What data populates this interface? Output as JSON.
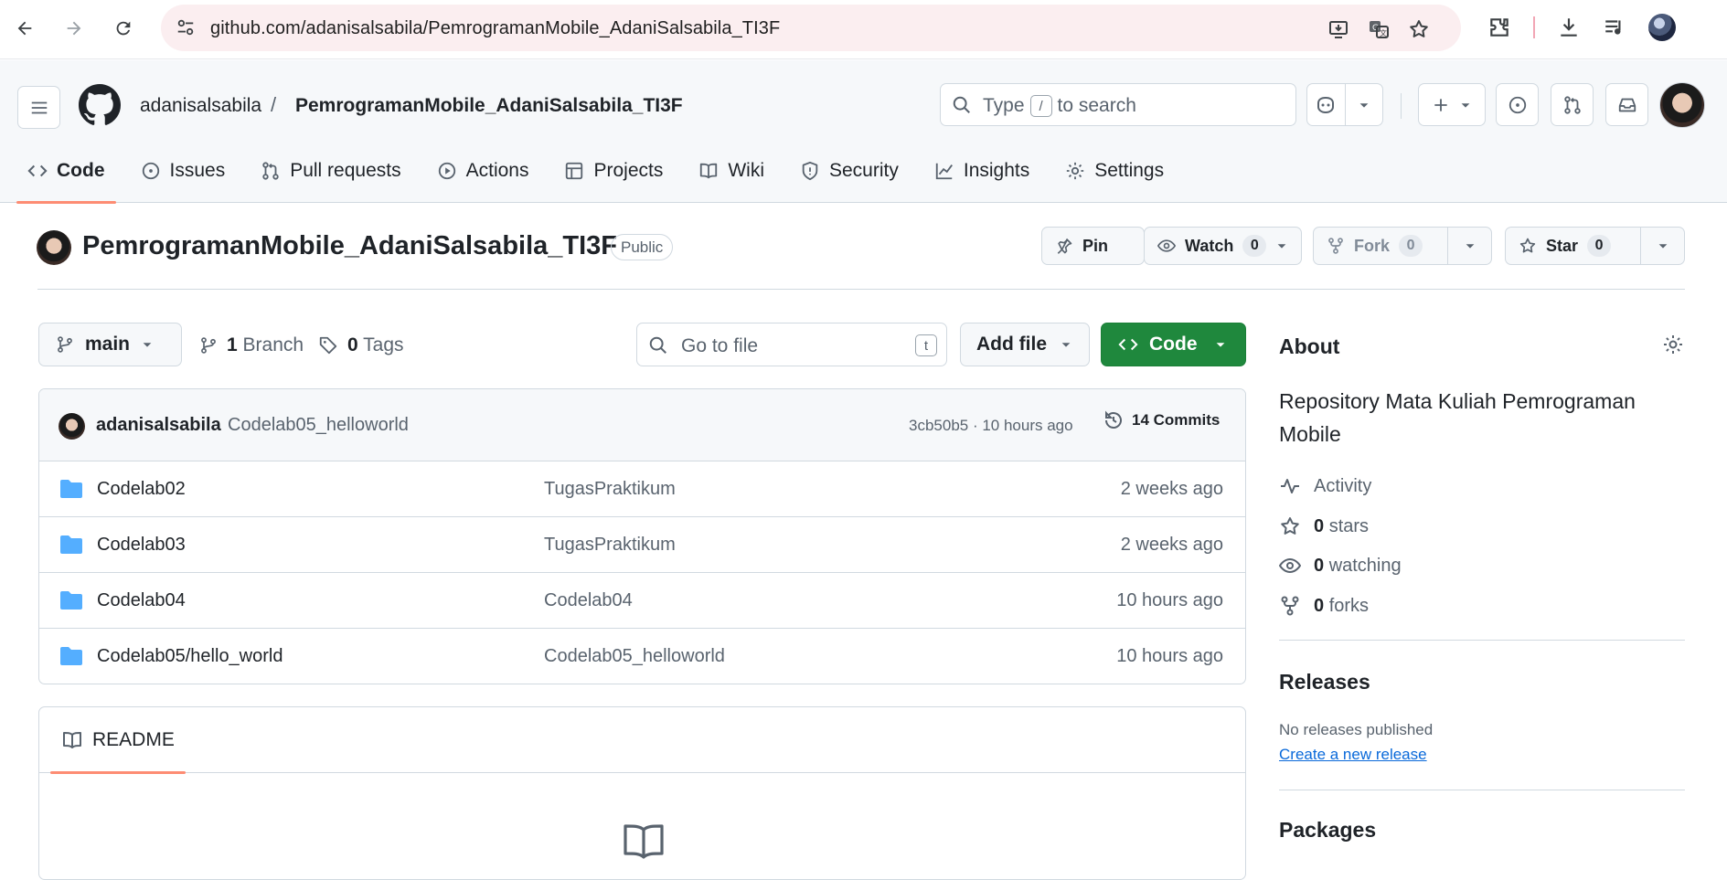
{
  "browser": {
    "url": "github.com/adanisalsabila/PemrogramanMobile_AdaniSalsabila_TI3F"
  },
  "header": {
    "owner": "adanisalsabila",
    "separator": "/",
    "repo": "PemrogramanMobile_AdaniSalsabila_TI3F",
    "search_prefix": "Type",
    "search_key": "/",
    "search_suffix": "to search"
  },
  "tabs": [
    {
      "label": "Code",
      "icon": "code-icon",
      "active": true
    },
    {
      "label": "Issues",
      "icon": "issue-icon"
    },
    {
      "label": "Pull requests",
      "icon": "pull-request-icon"
    },
    {
      "label": "Actions",
      "icon": "play-icon"
    },
    {
      "label": "Projects",
      "icon": "table-icon"
    },
    {
      "label": "Wiki",
      "icon": "book-icon"
    },
    {
      "label": "Security",
      "icon": "shield-icon"
    },
    {
      "label": "Insights",
      "icon": "graph-icon"
    },
    {
      "label": "Settings",
      "icon": "gear-icon"
    }
  ],
  "repo_header": {
    "title": "PemrogramanMobile_AdaniSalsabila_TI3F",
    "visibility": "Public",
    "pin_label": "Pin",
    "watch_label": "Watch",
    "watch_count": "0",
    "fork_label": "Fork",
    "fork_count": "0",
    "star_label": "Star",
    "star_count": "0"
  },
  "branch_bar": {
    "branch": "main",
    "branch_count": "1",
    "branch_word": "Branch",
    "tag_count": "0",
    "tag_word": "Tags",
    "goto_placeholder": "Go to file",
    "goto_key": "t",
    "add_file": "Add file",
    "code_button": "Code"
  },
  "latest_commit": {
    "author": "adanisalsabila",
    "message": "Codelab05_helloworld",
    "hash_time": "3cb50b5 · 10 hours ago",
    "commits": "14 Commits"
  },
  "files": [
    {
      "name": "Codelab02",
      "commit": "TugasPraktikum",
      "age": "2 weeks ago"
    },
    {
      "name": "Codelab03",
      "commit": "TugasPraktikum",
      "age": "2 weeks ago"
    },
    {
      "name": "Codelab04",
      "commit": "Codelab04",
      "age": "10 hours ago"
    },
    {
      "name": "Codelab05/hello_world",
      "commit": "Codelab05_helloworld",
      "age": "10 hours ago"
    }
  ],
  "readme": {
    "tab_label": "README"
  },
  "about": {
    "title": "About",
    "description": "Repository Mata Kuliah Pemrograman Mobile",
    "activity": "Activity",
    "stars_count": "0",
    "stars_label": "stars",
    "watching_count": "0",
    "watching_label": "watching",
    "forks_count": "0",
    "forks_label": "forks"
  },
  "releases": {
    "title": "Releases",
    "none_text": "No releases published",
    "create_link": "Create a new release"
  },
  "packages": {
    "title": "Packages"
  },
  "colors": {
    "primary_green": "#1f883d",
    "tab_underline": "#fd8c73",
    "link_blue": "#0969da",
    "folder_blue": "#54aeff"
  }
}
